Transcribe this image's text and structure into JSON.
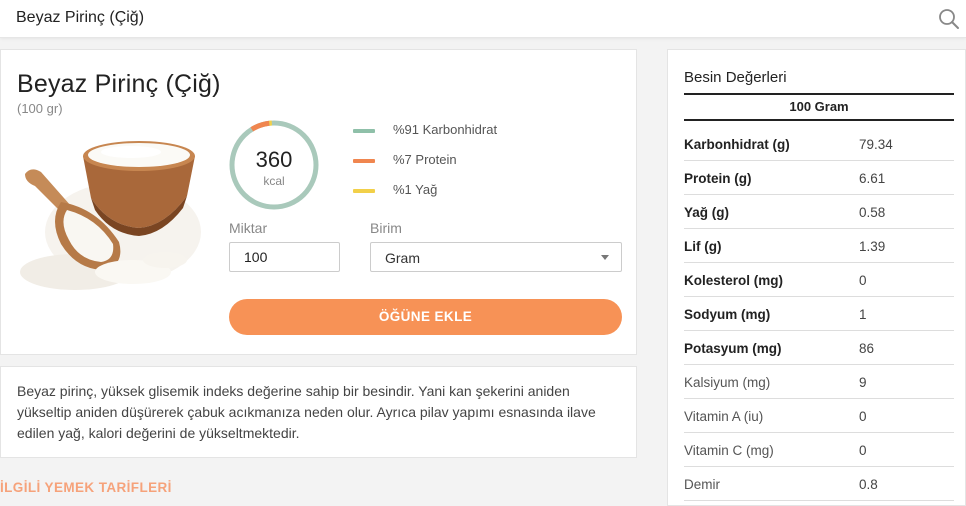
{
  "search": {
    "query": "Beyaz Pirinç (Çiğ)"
  },
  "food": {
    "title": "Beyaz Pirinç (Çiğ)",
    "portion": "(100 gr)",
    "calories": {
      "value": "360",
      "unit": "kcal"
    },
    "macros": [
      {
        "label": "%91 Karbonhidrat",
        "percent": 91,
        "color": "#8fc0a9"
      },
      {
        "label": "%7 Protein",
        "percent": 7,
        "color": "#f0864f"
      },
      {
        "label": "%1 Yağ",
        "percent": 1,
        "color": "#f2d049"
      }
    ],
    "quantity_label": "Miktar",
    "quantity_value": "100",
    "unit_label": "Birim",
    "unit_value": "Gram",
    "add_button": "ÖĞÜNE EKLE"
  },
  "description": "Beyaz pirinç, yüksek glisemik indeks değerine sahip bir besindir. Yani kan şekerini aniden yükseltip aniden düşürerek çabuk acıkmanıza neden olur. Ayrıca pilav yapımı esnasında ilave edilen yağ, kalori değerini de yükseltmektedir.",
  "related_title": "İLGİLİ YEMEK TARİFLERİ",
  "nutrition": {
    "title": "Besin Değerleri",
    "per": "100 Gram",
    "rows": [
      {
        "name": "Karbonhidrat (g)",
        "value": "79.34"
      },
      {
        "name": "Protein (g)",
        "value": "6.61"
      },
      {
        "name": "Yağ (g)",
        "value": "0.58"
      },
      {
        "name": "Lif (g)",
        "value": "1.39"
      },
      {
        "name": "Kolesterol (mg)",
        "value": "0"
      },
      {
        "name": "Sodyum (mg)",
        "value": "1"
      },
      {
        "name": "Potasyum (mg)",
        "value": "86"
      },
      {
        "name": "Kalsiyum (mg)",
        "value": "9"
      },
      {
        "name": "Vitamin A (iu)",
        "value": "0"
      },
      {
        "name": "Vitamin C (mg)",
        "value": "0"
      },
      {
        "name": "Demir",
        "value": "0.8"
      }
    ]
  }
}
